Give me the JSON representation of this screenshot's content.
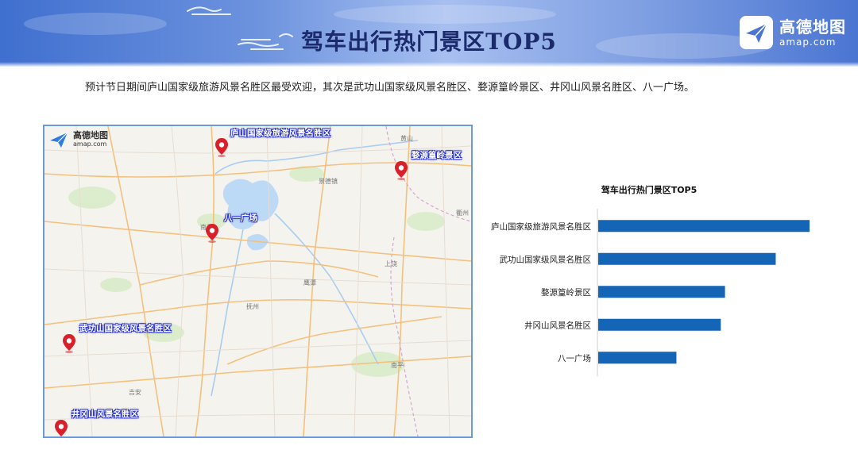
{
  "header": {
    "title": "驾车出行热门景区TOP5",
    "logo": {
      "cn": "高德地图",
      "en": "amap.com",
      "icon": "amap-plane-icon"
    }
  },
  "summary": "预计节日期间庐山国家级旅游风景名胜区最受欢迎，其次是武功山国家级风景名胜区、婺源篁岭景区、井冈山风景名胜区、八一广场。",
  "map": {
    "logo": {
      "cn": "高德地图",
      "en": "amap.com",
      "icon": "amap-plane-icon"
    },
    "pins": [
      {
        "label": "庐山国家级旅游风景名胜区",
        "icon": "map-pin-icon"
      },
      {
        "label": "婺源篁岭景区",
        "icon": "map-pin-icon"
      },
      {
        "label": "八一广场",
        "icon": "map-pin-icon"
      },
      {
        "label": "武功山国家级风景名胜区",
        "icon": "map-pin-icon"
      },
      {
        "label": "井冈山风景名胜区",
        "icon": "map-pin-icon"
      }
    ],
    "place_names": [
      "黄山",
      "景德镇",
      "衢州",
      "上饶",
      "南昌",
      "鹰潭",
      "抚州",
      "南平",
      "吉安"
    ]
  },
  "chart_data": {
    "type": "bar",
    "orientation": "horizontal",
    "title": "驾车出行热门景区TOP5",
    "categories": [
      "庐山国家级旅游风景名胜区",
      "武功山国家级风景名胜区",
      "婺源篁岭景区",
      "井冈山风景名胜区",
      "八一广场"
    ],
    "values": [
      1.0,
      0.84,
      0.6,
      0.58,
      0.37
    ],
    "xlabel": "",
    "ylabel": "",
    "xlim": [
      0,
      1.0
    ],
    "grid": false,
    "legend": "none",
    "bar_color": "#1565b7"
  },
  "colors": {
    "header_blue": "#4a75d2",
    "title_navy": "#1b2a6b",
    "map_border": "#6a9ad8",
    "pin_red": "#d9202a",
    "label_outline": "#2a33c9"
  }
}
